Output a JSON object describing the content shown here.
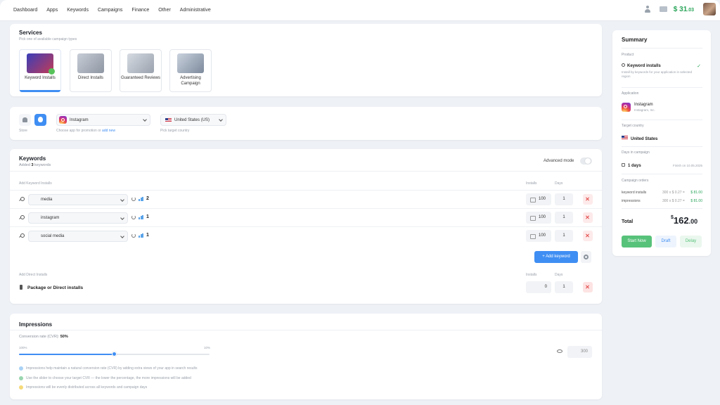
{
  "nav": {
    "items": [
      "Dashboard",
      "Apps",
      "Keywords",
      "Campaigns",
      "Finance",
      "Other",
      "Administrative"
    ],
    "balance_currency": "$",
    "balance_int": "31",
    "balance_cents": ".03"
  },
  "services": {
    "title": "Services",
    "subtitle": "Pick one of available campaign types",
    "items": [
      {
        "label": "Keyword Installs",
        "active": true
      },
      {
        "label": "Direct Installs",
        "active": false
      },
      {
        "label": "Guaranteed Reviews",
        "active": false
      },
      {
        "label": "Advertising Campaign",
        "active": false
      }
    ]
  },
  "store": {
    "store_label": "Store",
    "app_value": "Instagram",
    "app_hint": "Choose app for promotion or",
    "app_hint_link": "add new",
    "country_value": "United States (US)",
    "country_hint": "Pick target country"
  },
  "keywords": {
    "title": "Keywords",
    "added_prefix": "Added",
    "added_count": "3",
    "added_suffix": "keywords",
    "advanced_mode": "Advanced mode",
    "section_label": "Add Keyword Installs",
    "col_installs": "Installs",
    "col_days": "Days",
    "rows": [
      {
        "keyword": "media",
        "rank": "2",
        "installs": "100",
        "days": "1"
      },
      {
        "keyword": "instagram",
        "rank": "1",
        "installs": "100",
        "days": "1"
      },
      {
        "keyword": "social media",
        "rank": "1",
        "installs": "100",
        "days": "1"
      }
    ],
    "add_keyword": "+ Add keyword",
    "direct_label": "Add Direct Installs",
    "direct_row": {
      "label": "Package or Direct installs",
      "installs": "0",
      "days": "1"
    }
  },
  "impressions": {
    "title": "Impressions",
    "cvr_label": "Conversion rate (CVR):",
    "cvr_value": "50%",
    "slider_left": "100%",
    "slider_right": "10%",
    "slider_fraction": 0.5,
    "impressions_value": "300",
    "notes": [
      {
        "text": "Impressions help maintain a natural conversion rate (CVR) by adding extra views of your app in search results",
        "color": "#a9d2f5"
      },
      {
        "text": "Use the slider to choose your target CVR — the lower the percentage, the more impressions will be added",
        "color": "#9ad6b0"
      },
      {
        "text": "Impressions will be evenly distributed across all keywords and campaign days",
        "color": "#f5da7a"
      }
    ]
  },
  "summary": {
    "title": "Summary",
    "product_label": "Product",
    "product_value": "Keyword installs",
    "product_desc": "Install by keywords for your application in selected region",
    "application_label": "Application",
    "app_name": "Instagram",
    "app_dev": "Instagram, Inc.",
    "country_label": "Target country",
    "country_value": "United States",
    "days_label": "Days in campaign",
    "days_value": "1 days",
    "days_finish": "Finish on 10.05.2025",
    "orders_label": "Campaign orders",
    "orders": [
      {
        "name": "keyword installs",
        "calc": "300 x $ 0.27 =",
        "total": "$ 81.00"
      },
      {
        "name": "impressions",
        "calc": "300 x $ 0.27 =",
        "total": "$ 81.00"
      }
    ],
    "total_label": "Total",
    "total_currency": "$",
    "total_int": "162",
    "total_cents": ".00",
    "start_now": "Start Now",
    "draft": "Draft",
    "delay": "Delay"
  }
}
